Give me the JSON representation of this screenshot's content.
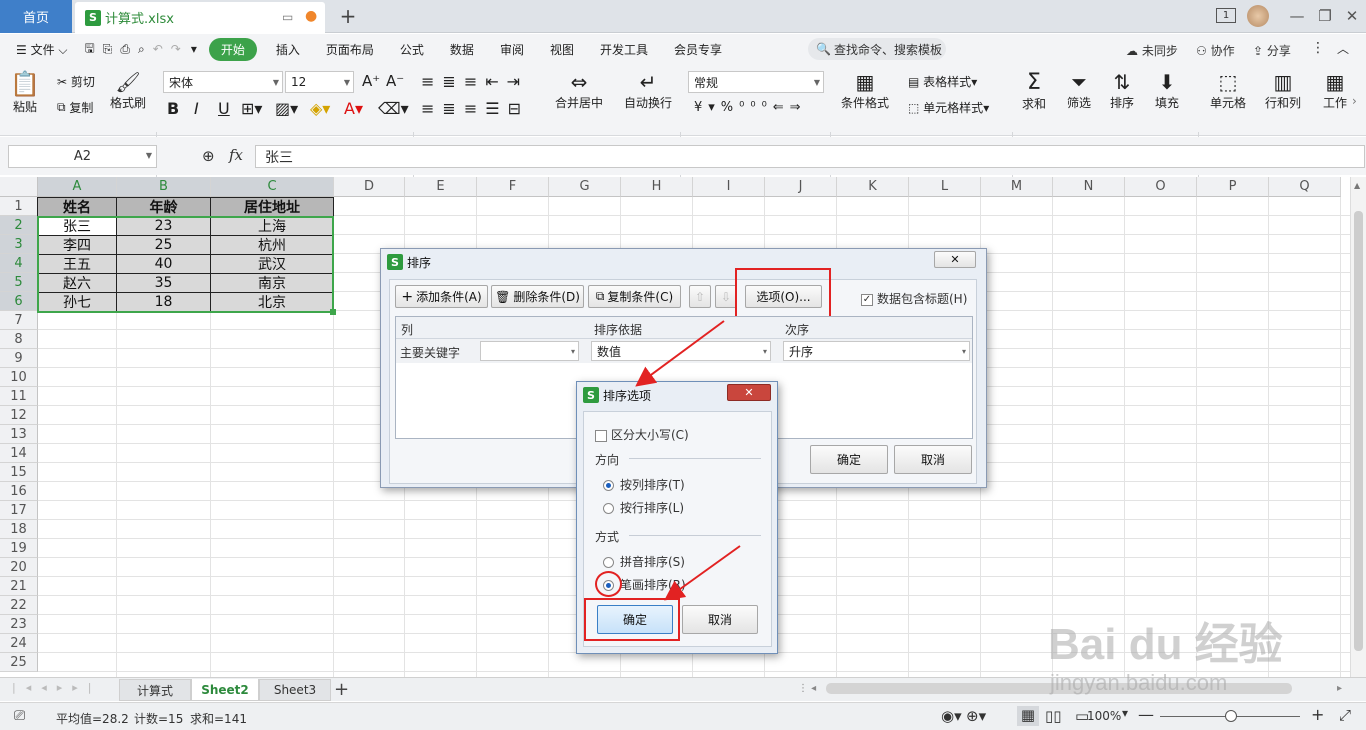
{
  "titlebar": {
    "home": "首页",
    "file": "计算式.xlsx",
    "badge": "1"
  },
  "menu": {
    "file": "文件",
    "items": [
      "开始",
      "插入",
      "页面布局",
      "公式",
      "数据",
      "审阅",
      "视图",
      "开发工具",
      "会员专享"
    ],
    "search": "查找命令、搜索模板",
    "sync": "未同步",
    "collab": "协作",
    "share": "分享"
  },
  "ribbon": {
    "paste": "粘贴",
    "cut": "剪切",
    "copy": "复制",
    "painter": "格式刷",
    "font": "宋体",
    "size": "12",
    "numfmt": "常规",
    "merge": "合并居中",
    "wrap": "自动换行",
    "cond": "条件格式",
    "tablestyle": "表格样式",
    "cellstyle": "单元格样式",
    "sum": "求和",
    "filter": "筛选",
    "sort": "排序",
    "fill": "填充",
    "cell": "单元格",
    "rowcol": "行和列",
    "sheet": "工作"
  },
  "formula": {
    "namebox": "A2",
    "fx": "fx",
    "content": "张三"
  },
  "columns": [
    "A",
    "B",
    "C",
    "D",
    "E",
    "F",
    "G",
    "H",
    "I",
    "J",
    "K",
    "L",
    "M",
    "N",
    "O",
    "P",
    "Q"
  ],
  "rows": [
    "1",
    "2",
    "3",
    "4",
    "5",
    "6",
    "7",
    "8",
    "9",
    "10",
    "11",
    "12",
    "13",
    "14",
    "15",
    "16",
    "17",
    "18",
    "19",
    "20",
    "21",
    "22",
    "23",
    "24",
    "25"
  ],
  "table": {
    "headers": [
      "姓名",
      "年龄",
      "居住地址"
    ],
    "rows": [
      [
        "张三",
        "23",
        "上海"
      ],
      [
        "李四",
        "25",
        "杭州"
      ],
      [
        "王五",
        "40",
        "武汉"
      ],
      [
        "赵六",
        "35",
        "南京"
      ],
      [
        "孙七",
        "18",
        "北京"
      ]
    ]
  },
  "sheets": [
    "计算式",
    "Sheet2",
    "Sheet3"
  ],
  "status": {
    "avg": "平均值=28.2",
    "count": "计数=15",
    "sum": "求和=141",
    "zoom": "100%"
  },
  "sortdlg": {
    "title": "排序",
    "add": "添加条件(A)",
    "del": "删除条件(D)",
    "copy": "复制条件(C)",
    "options": "选项(O)...",
    "hasheader": "数据包含标题(H)",
    "col_hdr": "列",
    "basis_hdr": "排序依据",
    "order_hdr": "次序",
    "key": "主要关键字",
    "basis": "数值",
    "order": "升序",
    "ok": "确定",
    "cancel": "取消"
  },
  "optdlg": {
    "title": "排序选项",
    "case": "区分大小写(C)",
    "direction": "方向",
    "by_col": "按列排序(T)",
    "by_row": "按行排序(L)",
    "method": "方式",
    "pinyin": "拼音排序(S)",
    "stroke": "笔画排序(R)",
    "ok": "确定",
    "cancel": "取消"
  },
  "watermark": {
    "brand": "Bai du 经验",
    "url": "jingyan.baidu.com"
  }
}
